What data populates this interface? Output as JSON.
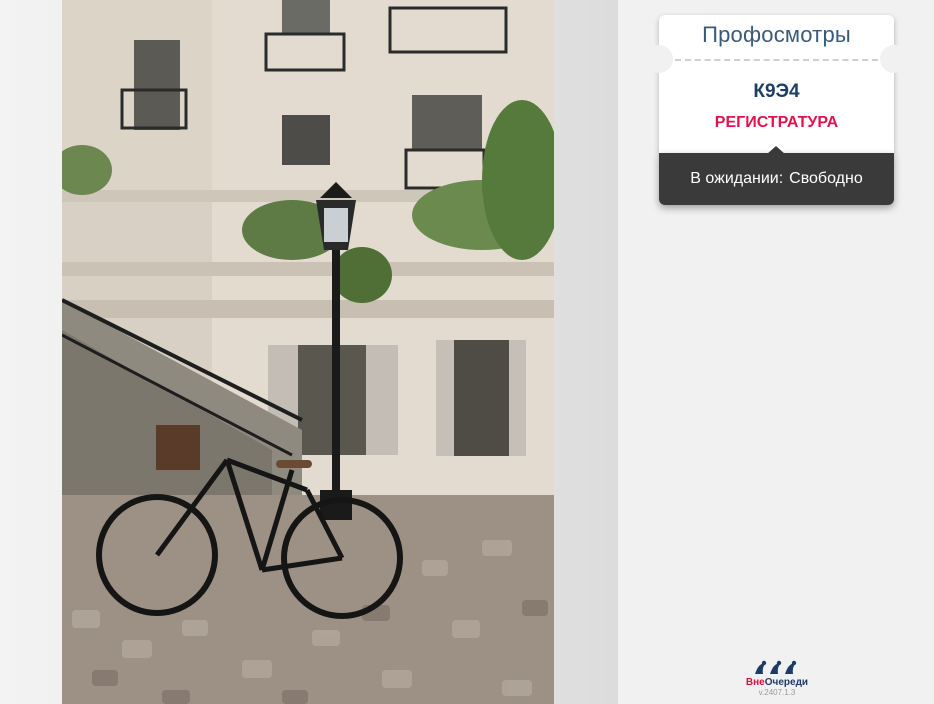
{
  "ticket": {
    "service": "Профосмотры",
    "number": "К9Э4",
    "desk": "РЕГИСТРАТУРА",
    "status_label": "В ожидании:",
    "status_value": "Свободно"
  },
  "branding": {
    "logo_part1": "Вне",
    "logo_part2": "Очереди",
    "version": "v.2407.1.3"
  },
  "colors": {
    "accent_blue": "#1d3f63",
    "accent_red": "#e0134d",
    "status_bar": "#3a3a3a"
  },
  "photo": {
    "alt": "Улица с велосипедом у фонаря перед зданием"
  }
}
